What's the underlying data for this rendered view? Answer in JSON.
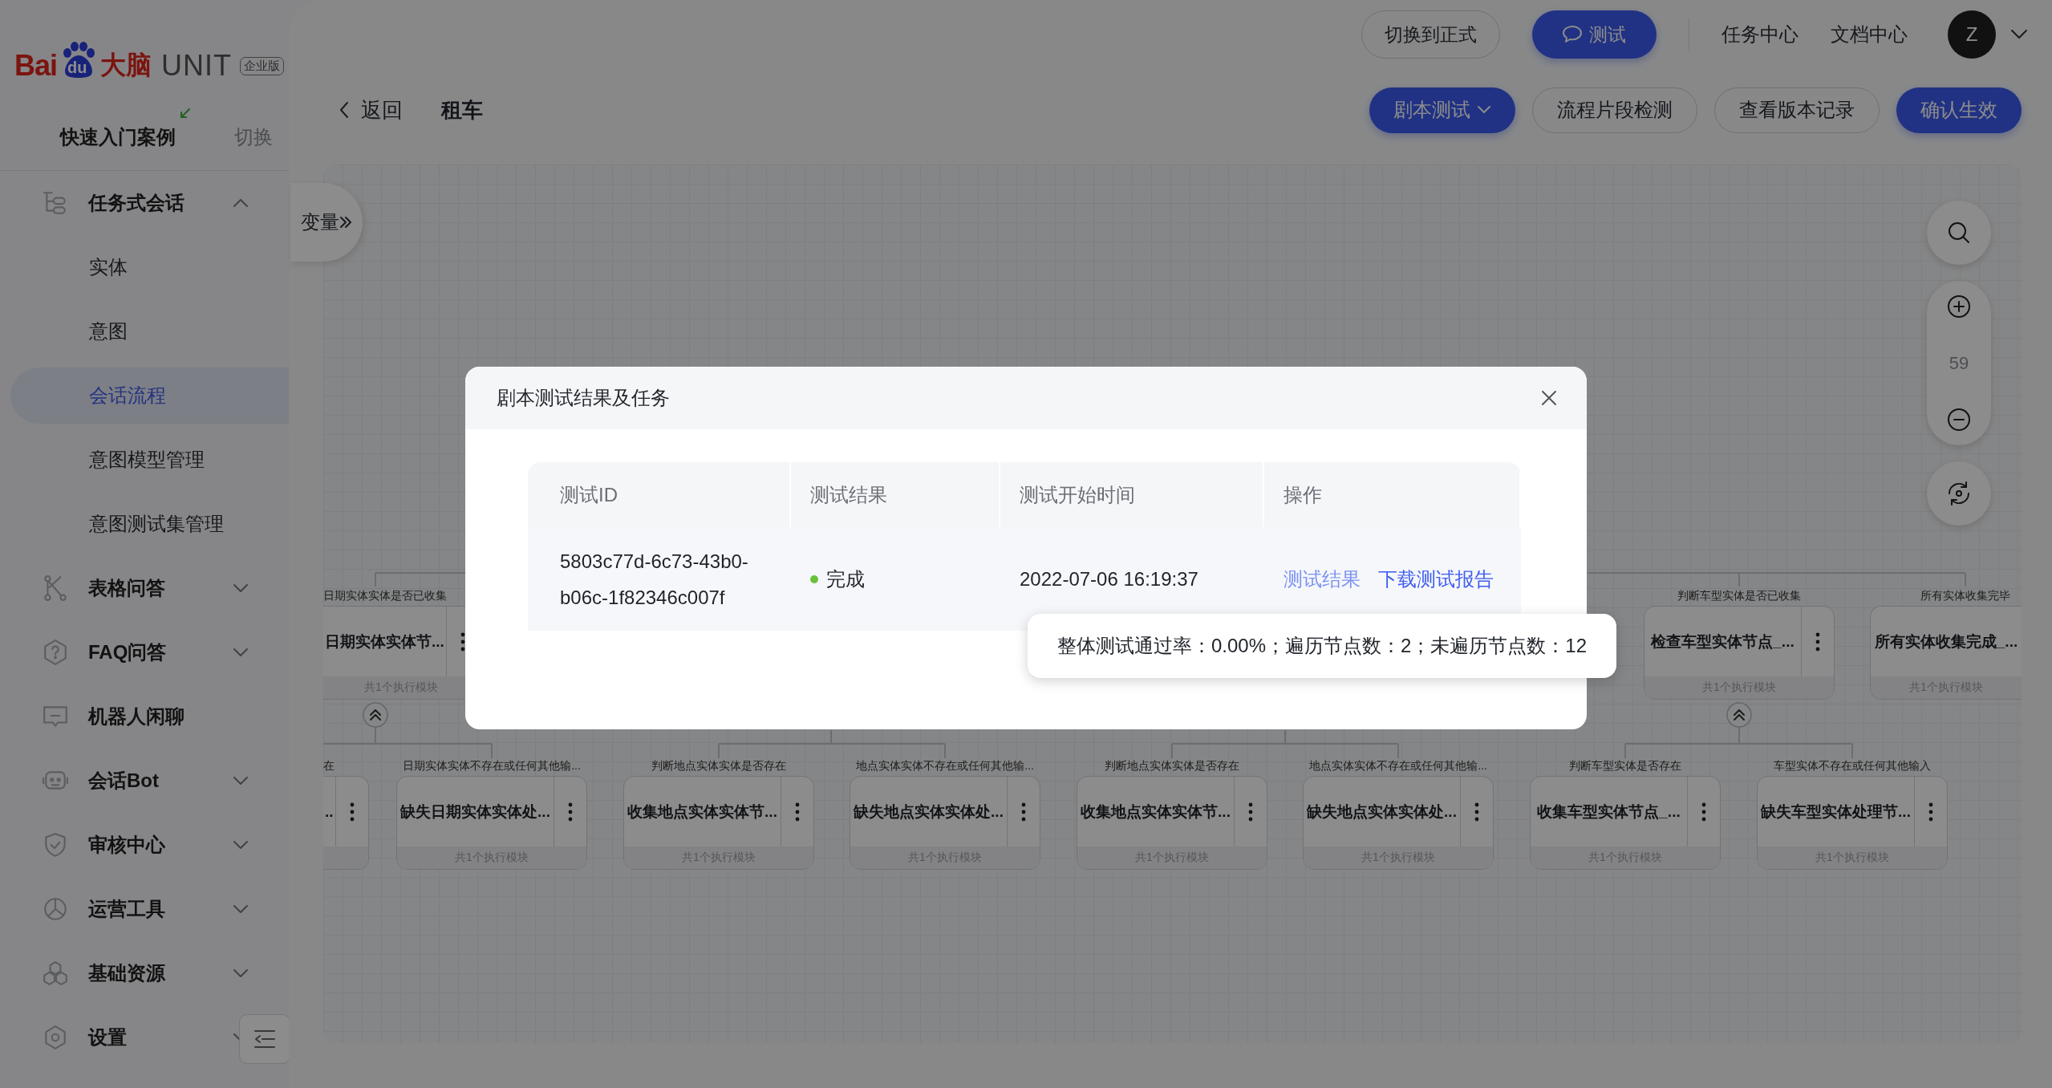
{
  "sidebar": {
    "logo": {
      "brand": "Bai",
      "paw_text": "du",
      "name": "大脑",
      "product": "UNIT",
      "edition": "企业版"
    },
    "quick_start": {
      "label": "快速入门案例",
      "switch": "切换"
    },
    "items": [
      {
        "label": "任务式会话",
        "selected": false,
        "expanded": true,
        "children": [
          {
            "label": "实体",
            "selected": false
          },
          {
            "label": "意图",
            "selected": false
          },
          {
            "label": "会话流程",
            "selected": true
          },
          {
            "label": "意图模型管理",
            "selected": false
          },
          {
            "label": "意图测试集管理",
            "selected": false
          }
        ]
      },
      {
        "label": "表格问答",
        "selected": false,
        "expanded": false
      },
      {
        "label": "FAQ问答",
        "selected": false,
        "expanded": false
      },
      {
        "label": "机器人闲聊",
        "selected": false
      },
      {
        "label": "会话Bot",
        "selected": false,
        "expanded": false
      },
      {
        "label": "审核中心",
        "selected": false,
        "expanded": false
      },
      {
        "label": "运营工具",
        "selected": false,
        "expanded": false
      },
      {
        "label": "基础资源",
        "selected": false,
        "expanded": false
      },
      {
        "label": "设置",
        "selected": false,
        "expanded": false
      }
    ]
  },
  "top_bar": {
    "buttons": [
      {
        "label": "切换到正式",
        "kind": "outline"
      },
      {
        "label": "测试",
        "kind": "primary"
      }
    ],
    "links": [
      "任务中心",
      "文档中心"
    ],
    "avatar": "Z"
  },
  "toolbar": {
    "back": "返回",
    "title": "租车",
    "buttons": [
      {
        "label": "剧本测试",
        "kind": "primary",
        "dropdown": true
      },
      {
        "label": "流程片段检测",
        "kind": "outline",
        "dropdown": false
      },
      {
        "label": "查看版本记录",
        "kind": "outline",
        "dropdown": false
      },
      {
        "label": "确认生效",
        "kind": "primary",
        "dropdown": false
      }
    ]
  },
  "variables_tab": "变量",
  "zoom": {
    "reading": "59"
  },
  "flow": {
    "rows": [
      {
        "nodes": [
          {
            "kind": "cut-left",
            "label": "日期实体实体是否已收集",
            "title": "日期实体实体节...",
            "footer": "共1个执行模块",
            "expanded": true
          },
          {
            "kind": "full",
            "label": "判断车型实体是否已收集",
            "title": "检查车型实体节点_...",
            "footer": "共1个执行模块",
            "expanded": true
          },
          {
            "kind": "cut-right",
            "label": "所有实体收集完毕",
            "title": "所有实体收集完成_...",
            "footer": "共1个执行模块"
          }
        ]
      },
      {
        "nodes": [
          {
            "kind": "cut-left",
            "label": "在",
            "title": ".."
          },
          {
            "kind": "full",
            "label": "日期实体实体不存在或任何其他输...",
            "title": "缺失日期实体实体处...",
            "footer": "共1个执行模块"
          },
          {
            "kind": "full",
            "label": "判断地点实体实体是否存在",
            "title": "收集地点实体实体节...",
            "footer": "共1个执行模块"
          },
          {
            "kind": "full",
            "label": "地点实体实体不存在或任何其他输...",
            "title": "缺失地点实体实体处...",
            "footer": "共1个执行模块"
          },
          {
            "kind": "full",
            "label": "判断地点实体实体是否存在",
            "title": "收集地点实体实体节...",
            "footer": "共1个执行模块"
          },
          {
            "kind": "full",
            "label": "地点实体实体不存在或任何其他输...",
            "title": "缺失地点实体实体处...",
            "footer": "共1个执行模块"
          },
          {
            "kind": "full",
            "label": "判断车型实体是否存在",
            "title": "收集车型实体节点_...",
            "footer": "共1个执行模块"
          },
          {
            "kind": "full",
            "label": "车型实体不存在或任何其他输入",
            "title": "缺失车型实体处理节...",
            "footer": "共1个执行模块"
          }
        ]
      }
    ]
  },
  "modal": {
    "title": "剧本测试结果及任务",
    "columns": [
      "测试ID",
      "测试结果",
      "测试开始时间",
      "操作"
    ],
    "rows": [
      {
        "id": "5803c77d-6c73-43b0-b06c-1f82346c007f",
        "status": {
          "text": "完成",
          "color": "#67c23a"
        },
        "start_time": "2022-07-06 16:19:37",
        "actions": [
          "测试结果",
          "下载测试报告"
        ]
      }
    ],
    "tooltip": "整体测试通过率：0.00%；遍历节点数：2；未遍历节点数：12"
  }
}
